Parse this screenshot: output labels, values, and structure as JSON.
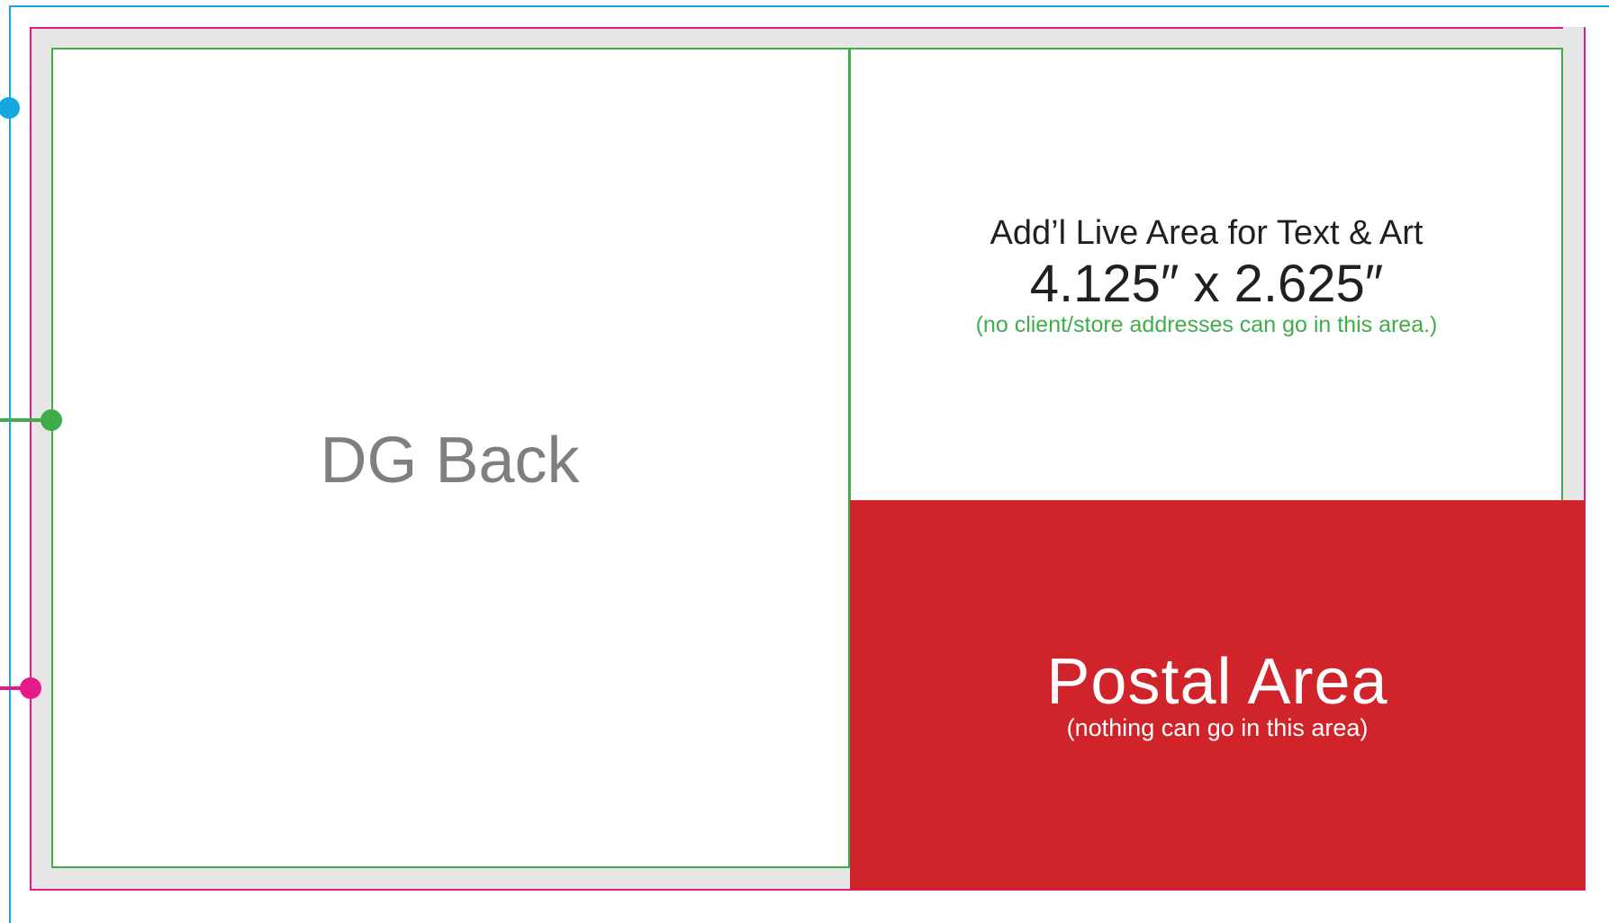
{
  "back": {
    "label": "DG Back"
  },
  "live_area": {
    "title": "Add’l Live Area for Text & Art",
    "dimensions": "4.125″ x 2.625″",
    "note": "(no client/store addresses can go in this area.)"
  },
  "postal": {
    "title": "Postal Area",
    "subtitle": "(nothing can go in this area)"
  },
  "colors": {
    "bleed_line": "#13a8e0",
    "trim_line": "#e6198a",
    "safe_line": "#3fae49",
    "postal_fill": "#d1232a",
    "margin_band": "#e6e6e6"
  }
}
